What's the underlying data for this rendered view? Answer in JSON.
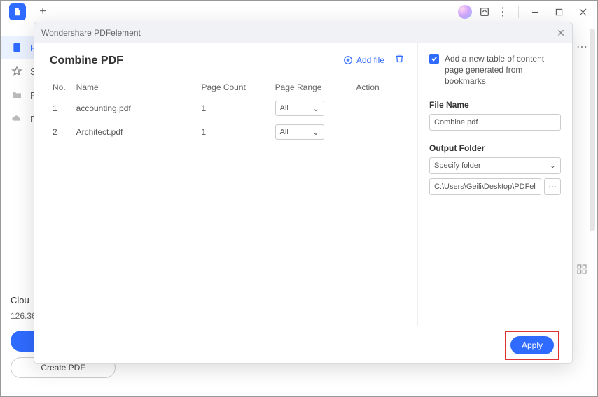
{
  "titlebar": {
    "newtab": "+"
  },
  "sidebar": {
    "items": [
      {
        "label": "R"
      },
      {
        "label": "St"
      },
      {
        "label": "R"
      },
      {
        "label": "D"
      }
    ]
  },
  "bottom": {
    "cloud": "Clou",
    "num": "126.36",
    "create": "Create PDF"
  },
  "modal": {
    "title": "Wondershare PDFelement",
    "heading": "Combine PDF",
    "add_file": "Add file",
    "columns": {
      "no": "No.",
      "name": "Name",
      "pc": "Page Count",
      "pr": "Page Range",
      "act": "Action"
    },
    "rows": [
      {
        "no": "1",
        "name": "accounting.pdf",
        "pc": "1",
        "pr": "All"
      },
      {
        "no": "2",
        "name": "Architect.pdf",
        "pc": "1",
        "pr": "All"
      }
    ],
    "right": {
      "chk_label": "Add a new table of content page generated from bookmarks",
      "file_name_label": "File Name",
      "file_name_value": "Combine.pdf",
      "output_label": "Output Folder",
      "output_select": "Specify folder",
      "output_path": "C:\\Users\\Geili\\Desktop\\PDFelement\\Cc"
    },
    "apply": "Apply"
  }
}
